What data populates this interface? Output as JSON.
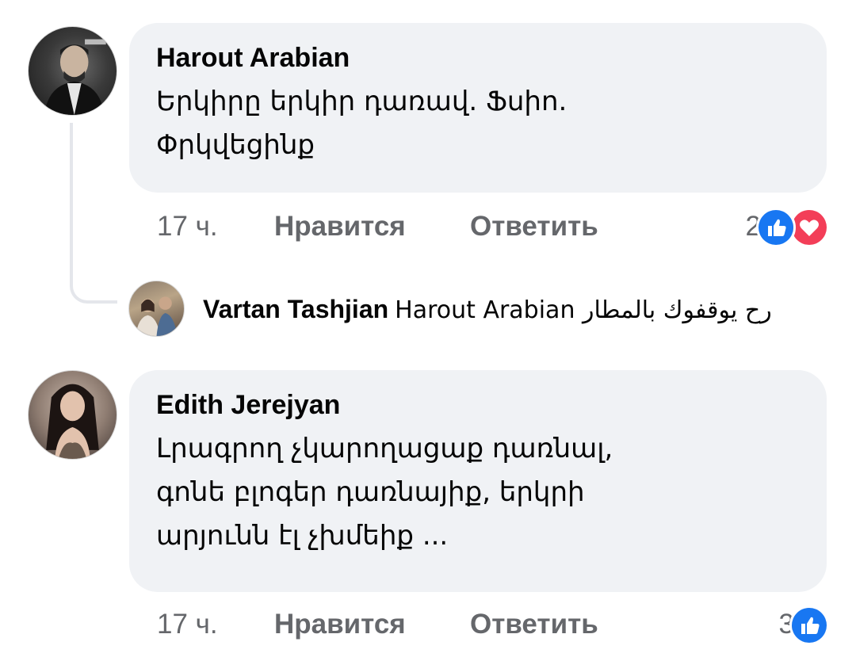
{
  "comments": [
    {
      "author": "Harout Arabian",
      "lines": [
        "Երկիրը երկիր դառավ. Ֆսիո.",
        "Փրկվեցինք"
      ],
      "time": "17 ч.",
      "like_label": "Нравится",
      "reply_label": "Ответить",
      "reaction_count": "2",
      "reactions": [
        "like-icon",
        "love-icon"
      ],
      "avatar_icon": "profile-photo"
    },
    {
      "author": "Edith Jerejyan",
      "lines": [
        "Լրագրող չկարողացաք դառնալ,",
        "գոնե բլոգեր դառնայիք, երկրի",
        "արյունն էլ չխմեիք ..."
      ],
      "time": "17 ч.",
      "like_label": "Нравится",
      "reply_label": "Ответить",
      "reaction_count": "3",
      "reactions": [
        "like-icon"
      ],
      "avatar_icon": "profile-photo"
    }
  ],
  "reply": {
    "author": "Vartan Tashjian",
    "text": "Harout Arabian رح يوقفوك بالمطار"
  },
  "colors": {
    "bubble_bg": "#f0f2f5",
    "meta_text": "#65676b",
    "like_blue": "#1877f2",
    "love_red": "#f33e58",
    "thread_line": "#e4e6eb"
  }
}
